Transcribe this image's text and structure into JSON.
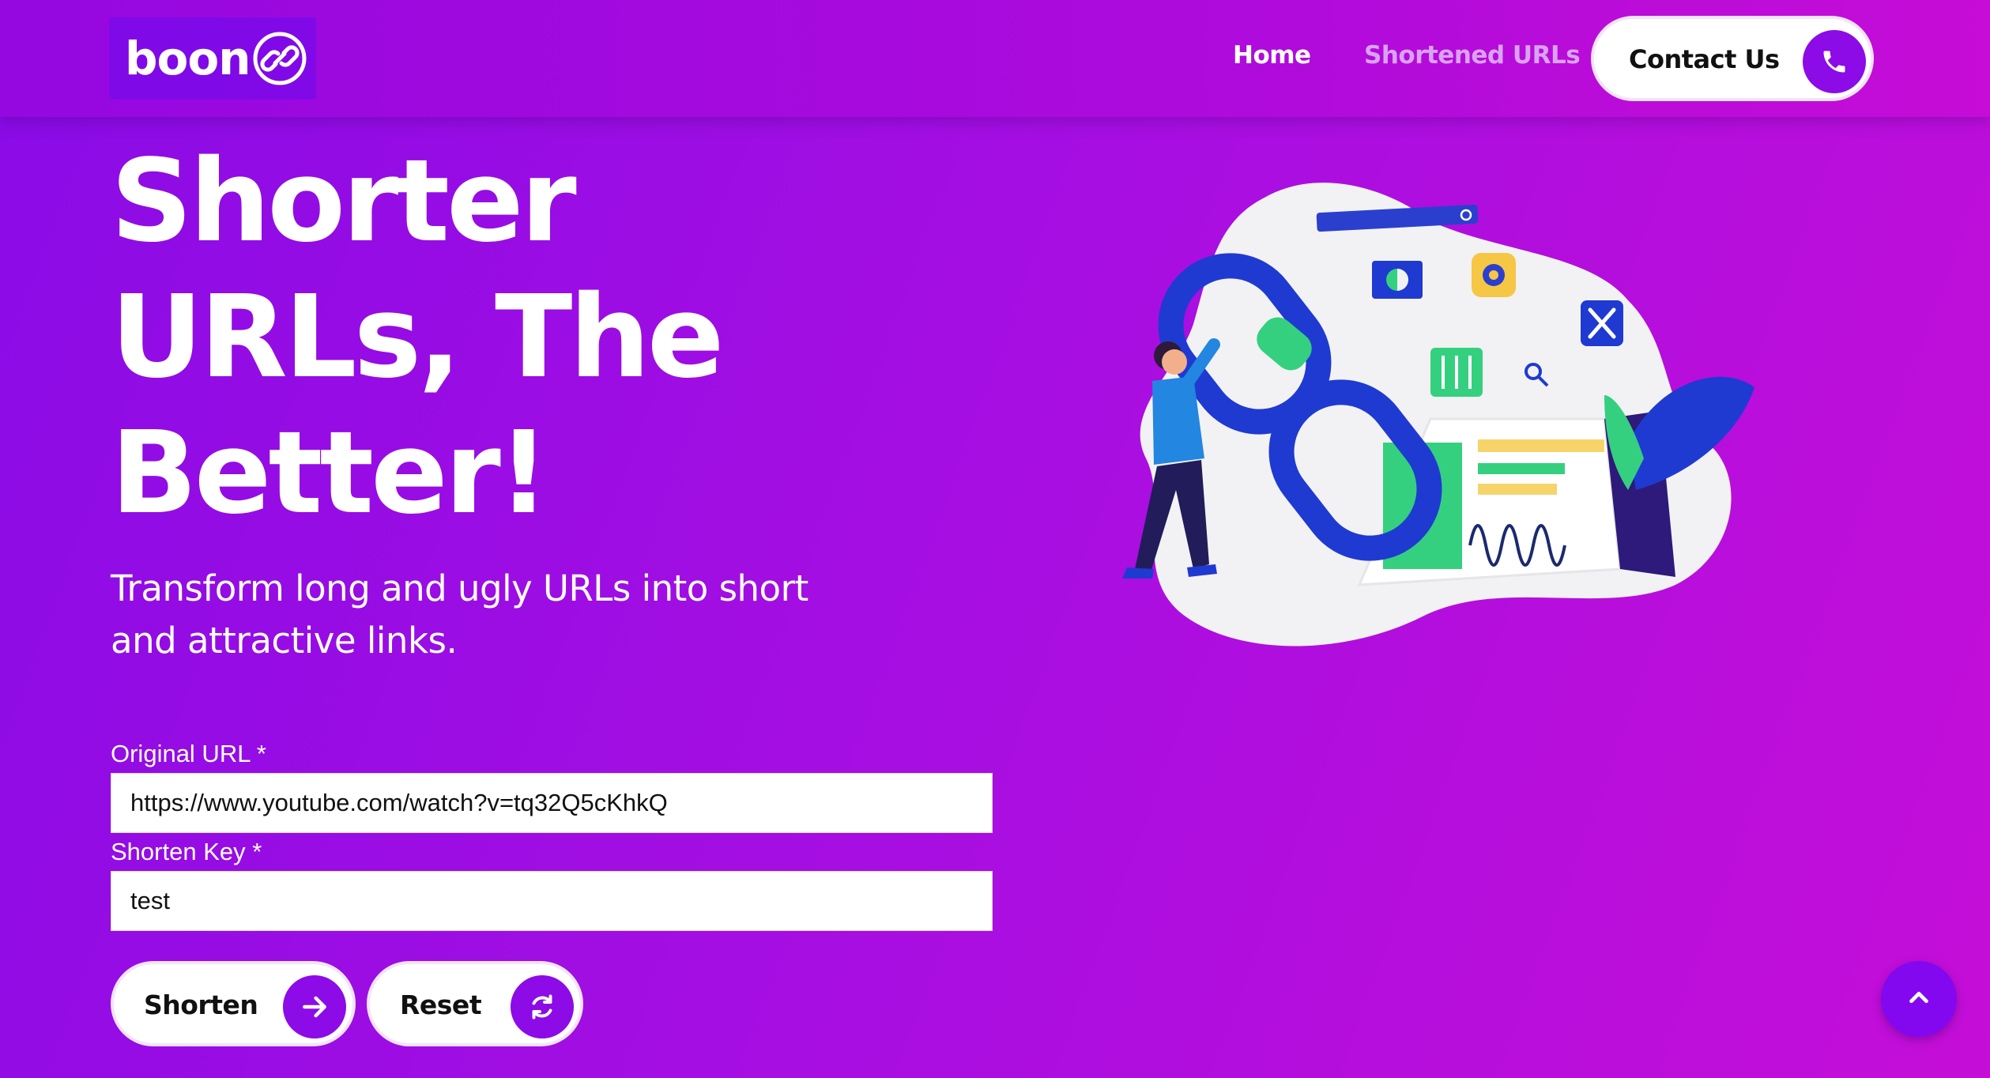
{
  "brand": {
    "logo_text": "boon"
  },
  "nav": {
    "home_label": "Home",
    "shortened_label": "Shortened URLs",
    "contact_label": "Contact Us"
  },
  "hero": {
    "title_line1": "Shorter",
    "title_line2": "URLs, The",
    "title_line3": "Better!",
    "subtitle_line1": "Transform long and ugly URLs into short",
    "subtitle_line2": "and attractive links."
  },
  "form": {
    "original_url_label": "Original URL *",
    "original_url_value": "https://www.youtube.com/watch?v=tq32Q5cKhkQ",
    "shorten_key_label": "Shorten Key *",
    "shorten_key_value": "test",
    "shorten_button": "Shorten",
    "reset_button": "Reset"
  },
  "icons": {
    "logo": "link-icon",
    "contact": "phone-icon",
    "shorten": "arrow-right-icon",
    "reset": "refresh-icon",
    "scroll_top": "chevron-up-icon"
  },
  "colors": {
    "accent": "#8c0be6",
    "background_start": "#8a0be6",
    "background_end": "#c50ed8",
    "nav_inactive": "#d9a3f2"
  }
}
